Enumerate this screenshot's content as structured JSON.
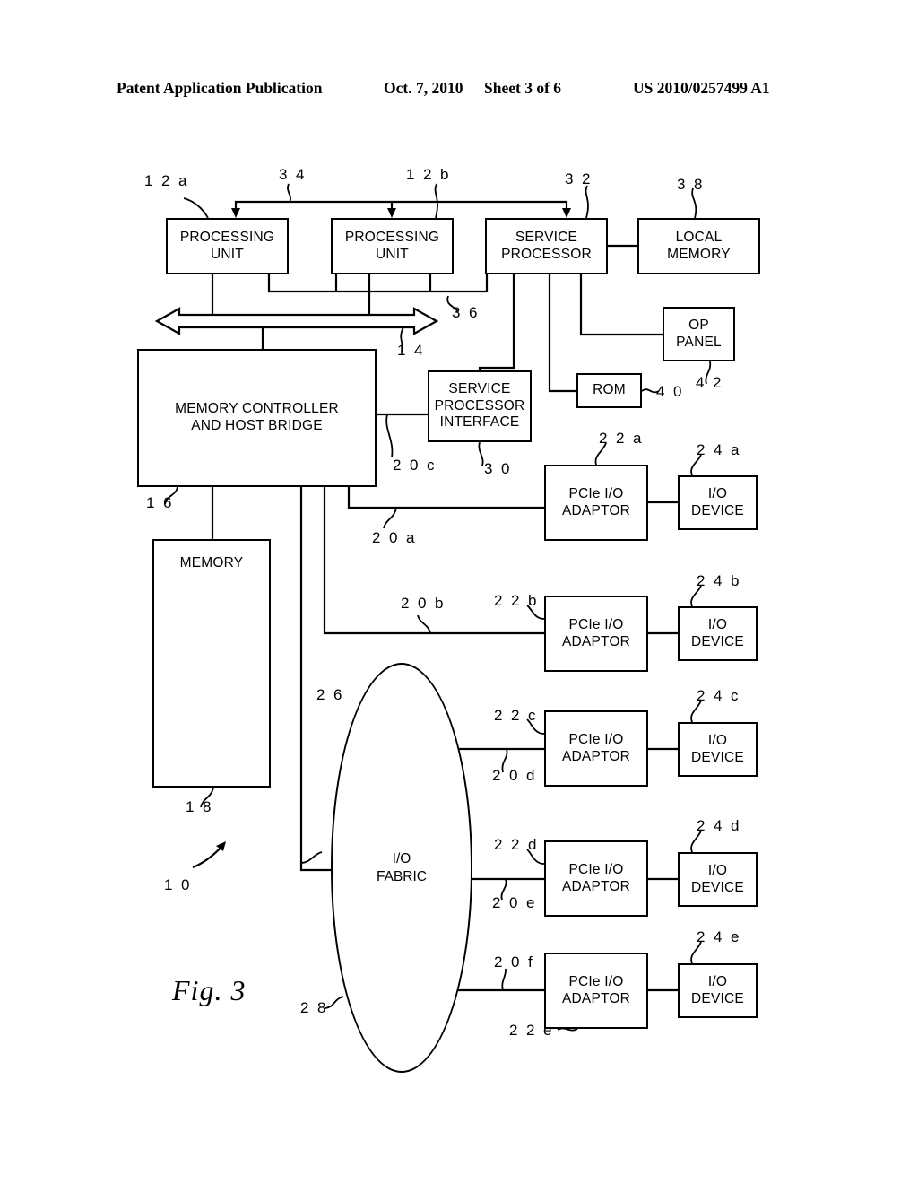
{
  "header": {
    "publication": "Patent Application Publication",
    "date": "Oct. 7, 2010",
    "sheet": "Sheet 3 of 6",
    "number": "US 2010/0257499 A1"
  },
  "figure": {
    "label": "Fig. 3",
    "system_ref": "1 0"
  },
  "blocks": {
    "processing_unit_a": "PROCESSING\nUNIT",
    "processing_unit_b": "PROCESSING\nUNIT",
    "service_processor": "SERVICE\nPROCESSOR",
    "local_memory": "LOCAL\nMEMORY",
    "op_panel": "OP\nPANEL",
    "rom": "ROM",
    "memory_controller": "MEMORY CONTROLLER\nAND HOST BRIDGE",
    "service_processor_interface": "SERVICE\nPROCESSOR\nINTERFACE",
    "memory": "MEMORY",
    "io_fabric": "I/O\nFABRIC",
    "pcie_adaptor_a": "PCIe I/O\nADAPTOR",
    "pcie_adaptor_b": "PCIe I/O\nADAPTOR",
    "pcie_adaptor_c": "PCIe I/O\nADAPTOR",
    "pcie_adaptor_d": "PCIe I/O\nADAPTOR",
    "pcie_adaptor_e": "PCIe I/O\nADAPTOR",
    "io_device_a": "I/O\nDEVICE",
    "io_device_b": "I/O\nDEVICE",
    "io_device_c": "I/O\nDEVICE",
    "io_device_d": "I/O\nDEVICE",
    "io_device_e": "I/O\nDEVICE"
  },
  "refs": {
    "r12a": "1 2 a",
    "r34": "3 4",
    "r12b": "1 2 b",
    "r32": "3 2",
    "r38": "3 8",
    "r36": "3 6",
    "r14": "1 4",
    "r40": "4 0",
    "r42": "4 2",
    "r16": "1 6",
    "r18": "1 8",
    "r20a": "2 0 a",
    "r20b": "2 0 b",
    "r20c": "2 0 c",
    "r20d": "2 0 d",
    "r20e": "2 0 e",
    "r20f": "2 0 f",
    "r22a": "2 2 a",
    "r22b": "2 2 b",
    "r22c": "2 2 c",
    "r22d": "2 2 d",
    "r22e": "2 2 e",
    "r24a": "2 4 a",
    "r24b": "2 4 b",
    "r24c": "2 4 c",
    "r24d": "2 4 d",
    "r24e": "2 4 e",
    "r26": "2 6",
    "r28": "2 8",
    "r30": "3 0"
  }
}
